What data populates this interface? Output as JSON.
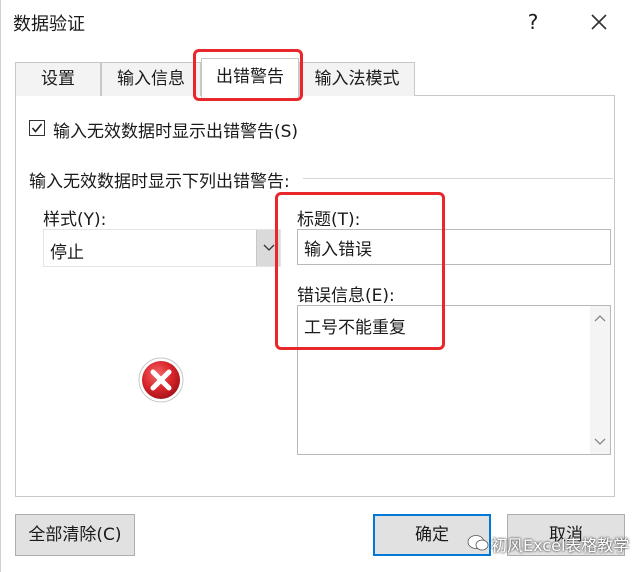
{
  "window": {
    "title": "数据验证",
    "help_label": "?",
    "close_icon": "close-icon"
  },
  "tabs": [
    {
      "label": "设置",
      "active": false
    },
    {
      "label": "输入信息",
      "active": false
    },
    {
      "label": "出错警告",
      "active": true
    },
    {
      "label": "输入法模式",
      "active": false
    }
  ],
  "show_error": {
    "checked": true,
    "label": "输入无效数据时显示出错警告(S)"
  },
  "section_label": "输入无效数据时显示下列出错警告:",
  "style": {
    "label": "样式(Y):",
    "value": "停止",
    "icon": "error-stop-icon"
  },
  "alert_title": {
    "label": "标题(T):",
    "value": "输入错误"
  },
  "error_message": {
    "label": "错误信息(E):",
    "value": "工号不能重复"
  },
  "buttons": {
    "clear_all": "全部清除(C)",
    "ok": "确定",
    "cancel": "取消"
  },
  "watermark": "初风Excel表格教学",
  "colors": {
    "highlight": "#e8272a",
    "primary_border": "#0078d7",
    "error_icon": "#d9252b"
  }
}
